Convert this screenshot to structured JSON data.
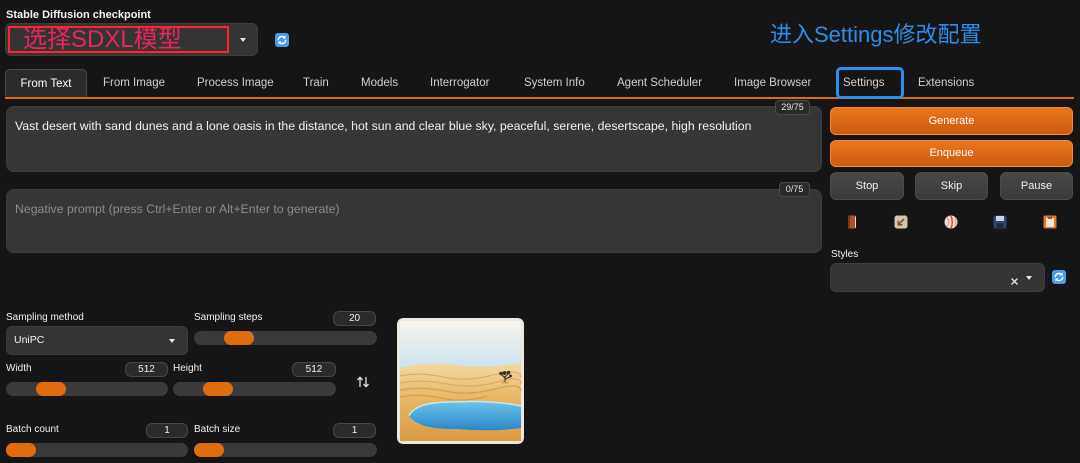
{
  "checkpoint": {
    "label": "Stable Diffusion checkpoint"
  },
  "annotations": {
    "checkpoint_note": "选择SDXL模型",
    "settings_note": "进入Settings修改配置"
  },
  "tabs": [
    "From Text",
    "From Image",
    "Process Image",
    "Train",
    "Models",
    "Interrogator",
    "System Info",
    "Agent Scheduler",
    "Image Browser",
    "Settings",
    "Extensions"
  ],
  "active_tab_index": 0,
  "prompt": {
    "value": "Vast desert with sand dunes and a lone oasis in the distance, hot sun and clear blue sky, peaceful, serene, desertscape, high resolution",
    "token_count": "29/75"
  },
  "negative_prompt": {
    "value": "",
    "placeholder": "Negative prompt (press Ctrl+Enter or Alt+Enter to generate)",
    "token_count": "0/75"
  },
  "actions": {
    "generate": "Generate",
    "enqueue": "Enqueue",
    "stop": "Stop",
    "skip": "Skip",
    "pause": "Pause"
  },
  "tool_icons": [
    "book-icon",
    "arrow-box-icon",
    "flower-card-icon",
    "floppy-disk-icon",
    "clipboard-icon"
  ],
  "styles": {
    "label": "Styles"
  },
  "params": {
    "sampling_method": {
      "label": "Sampling method",
      "value": "UniPC"
    },
    "sampling_steps": {
      "label": "Sampling steps",
      "value": 20
    },
    "width": {
      "label": "Width",
      "value": 512
    },
    "height": {
      "label": "Height",
      "value": 512
    },
    "batch_count": {
      "label": "Batch count",
      "value": 1
    },
    "batch_size": {
      "label": "Batch size",
      "value": 1
    }
  },
  "icons": {
    "refresh": "refresh-icon",
    "swap": "swap-arrows-icon",
    "clear": "close-icon",
    "dropdown": "chevron-down-icon"
  },
  "colors": {
    "page_background": "#151515",
    "accent": "#e06c10",
    "annotation_red": "#e8255c",
    "annotation_blue": "#2d8de8"
  }
}
